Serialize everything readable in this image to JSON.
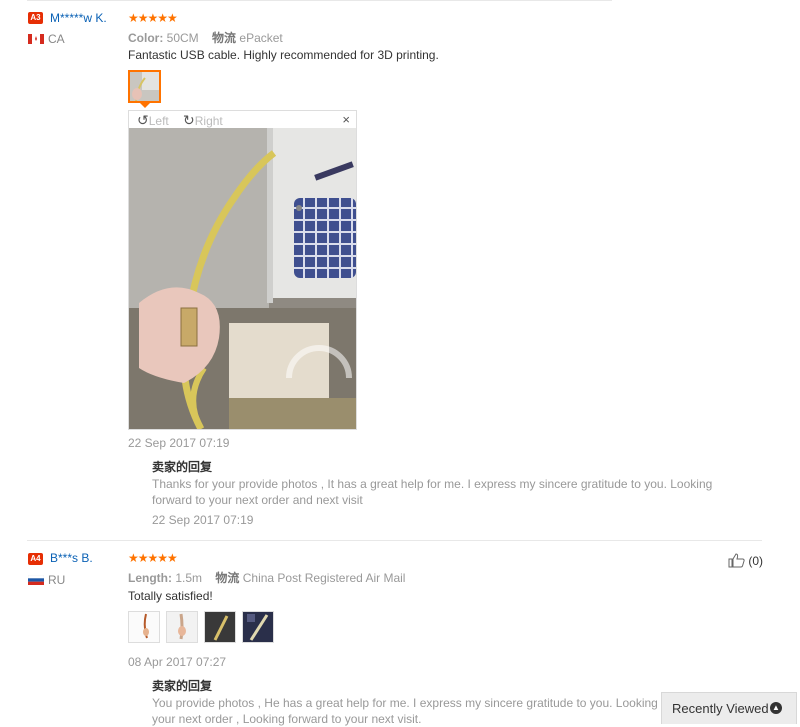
{
  "reviews": [
    {
      "badge": "A3",
      "user": "M*****w K.",
      "country": "CA",
      "stars": "★★★★★",
      "attr_key": "Color:",
      "attr_val": "50CM",
      "ship_key": "物流",
      "ship_val": "ePacket",
      "text": "Fantastic USB cable. Highly recommended for 3D printing.",
      "date": "22 Sep 2017 07:19",
      "reply_title": "卖家的回复",
      "reply_line1": "Thanks for your provide photos , It has a great help for me. I express my sincere gratitude to you. Looking",
      "reply_line2": "forward to your next order and next visit",
      "reply_date": "22 Sep 2017 07:19",
      "viewer": {
        "left_label": "Left",
        "right_label": "Right",
        "close": "×"
      }
    },
    {
      "badge": "A4",
      "user": "B***s B.",
      "country": "RU",
      "stars": "★★★★★",
      "attr_key": "Length:",
      "attr_val": "1.5m",
      "ship_key": "物流",
      "ship_val": "China Post Registered Air Mail",
      "text": "Totally satisfied!",
      "helpful": "(0)",
      "date": "08 Apr 2017 07:27",
      "reply_title": "卖家的回复",
      "reply_line1": "You provide photos , He has a great help for me. I express my sincere gratitude to you. Looking forward to",
      "reply_line2": "your next order , Looking forward to your next visit."
    }
  ],
  "recently_viewed": "Recently Viewed",
  "colors": {
    "accent": "#ff7300",
    "link": "#0a61b5",
    "badge": "#e62e04"
  }
}
